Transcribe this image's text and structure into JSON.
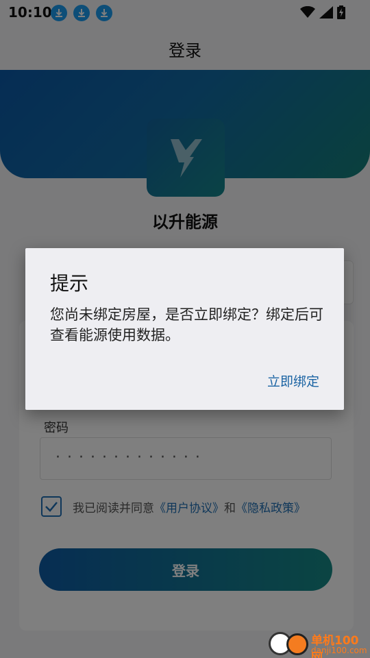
{
  "status_bar": {
    "time": "10:10",
    "icons": [
      "download-icon",
      "download-icon",
      "download-icon",
      "wifi-icon",
      "signal-icon",
      "battery-charging-icon"
    ]
  },
  "app_bar": {
    "title": "登录"
  },
  "brand": {
    "name": "以升能源",
    "logo_icon": "lightning-y-icon"
  },
  "form": {
    "password_label": "密码",
    "password_value": "·············",
    "agree_prefix": "我已阅读并同意",
    "user_agreement": "《用户协议》",
    "and": "和",
    "privacy_policy": "《隐私政策》",
    "agree_checked": true,
    "login_button": "登录"
  },
  "dialog": {
    "title": "提示",
    "message": "您尚未绑定房屋，是否立即绑定？绑定后可查看能源使用数据。",
    "action": "立即绑定"
  },
  "watermark": {
    "line1": "单机100网",
    "line2": "danji100.com"
  },
  "colors": {
    "primary": "#0e5ca6",
    "teal": "#168a86",
    "dialog_action": "#1a63a3",
    "download_badge": "#1a9cf0"
  }
}
